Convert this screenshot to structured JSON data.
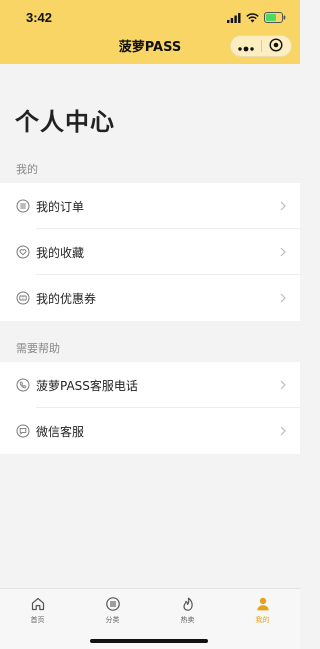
{
  "status_bar": {
    "time": "3:42"
  },
  "nav": {
    "title": "菠萝PASS"
  },
  "page": {
    "title": "个人中心"
  },
  "sections": [
    {
      "label": "我的",
      "items": [
        {
          "label": "我的订单",
          "icon": "list-circle-icon"
        },
        {
          "label": "我的收藏",
          "icon": "heart-circle-icon"
        },
        {
          "label": "我的优惠券",
          "icon": "coupon-circle-icon"
        }
      ]
    },
    {
      "label": "需要帮助",
      "items": [
        {
          "label": "菠萝PASS客服电话",
          "icon": "phone-circle-icon"
        },
        {
          "label": "微信客服",
          "icon": "chat-circle-icon"
        }
      ]
    }
  ],
  "tabbar": {
    "tabs": [
      {
        "label": "首页",
        "icon": "home-icon",
        "active": false
      },
      {
        "label": "分类",
        "icon": "list-icon",
        "active": false
      },
      {
        "label": "热卖",
        "icon": "flame-icon",
        "active": false
      },
      {
        "label": "我的",
        "icon": "person-icon",
        "active": true
      }
    ]
  },
  "colors": {
    "header_bg": "#f9d565",
    "accent": "#e7a21d",
    "page_bg": "#f3f3f3"
  }
}
